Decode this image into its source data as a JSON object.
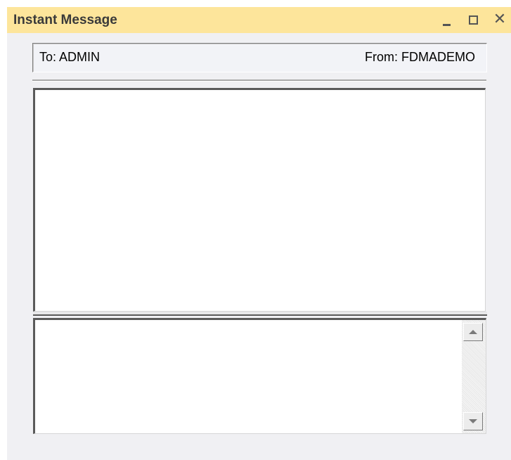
{
  "window": {
    "title": "Instant Message",
    "accent_color": "#fde59b"
  },
  "titlebar_buttons": {
    "minimize_icon": "minimize-icon",
    "maximize_icon": "maximize-icon",
    "close_icon": "close-icon",
    "close_glyph": "✕"
  },
  "header": {
    "to_text": "To: ADMIN",
    "from_text": "From: FDMADEMO"
  },
  "compose": {
    "value": "",
    "placeholder": ""
  },
  "scrollbar": {
    "up_icon": "arrow-up-icon",
    "down_icon": "arrow-down-icon"
  }
}
